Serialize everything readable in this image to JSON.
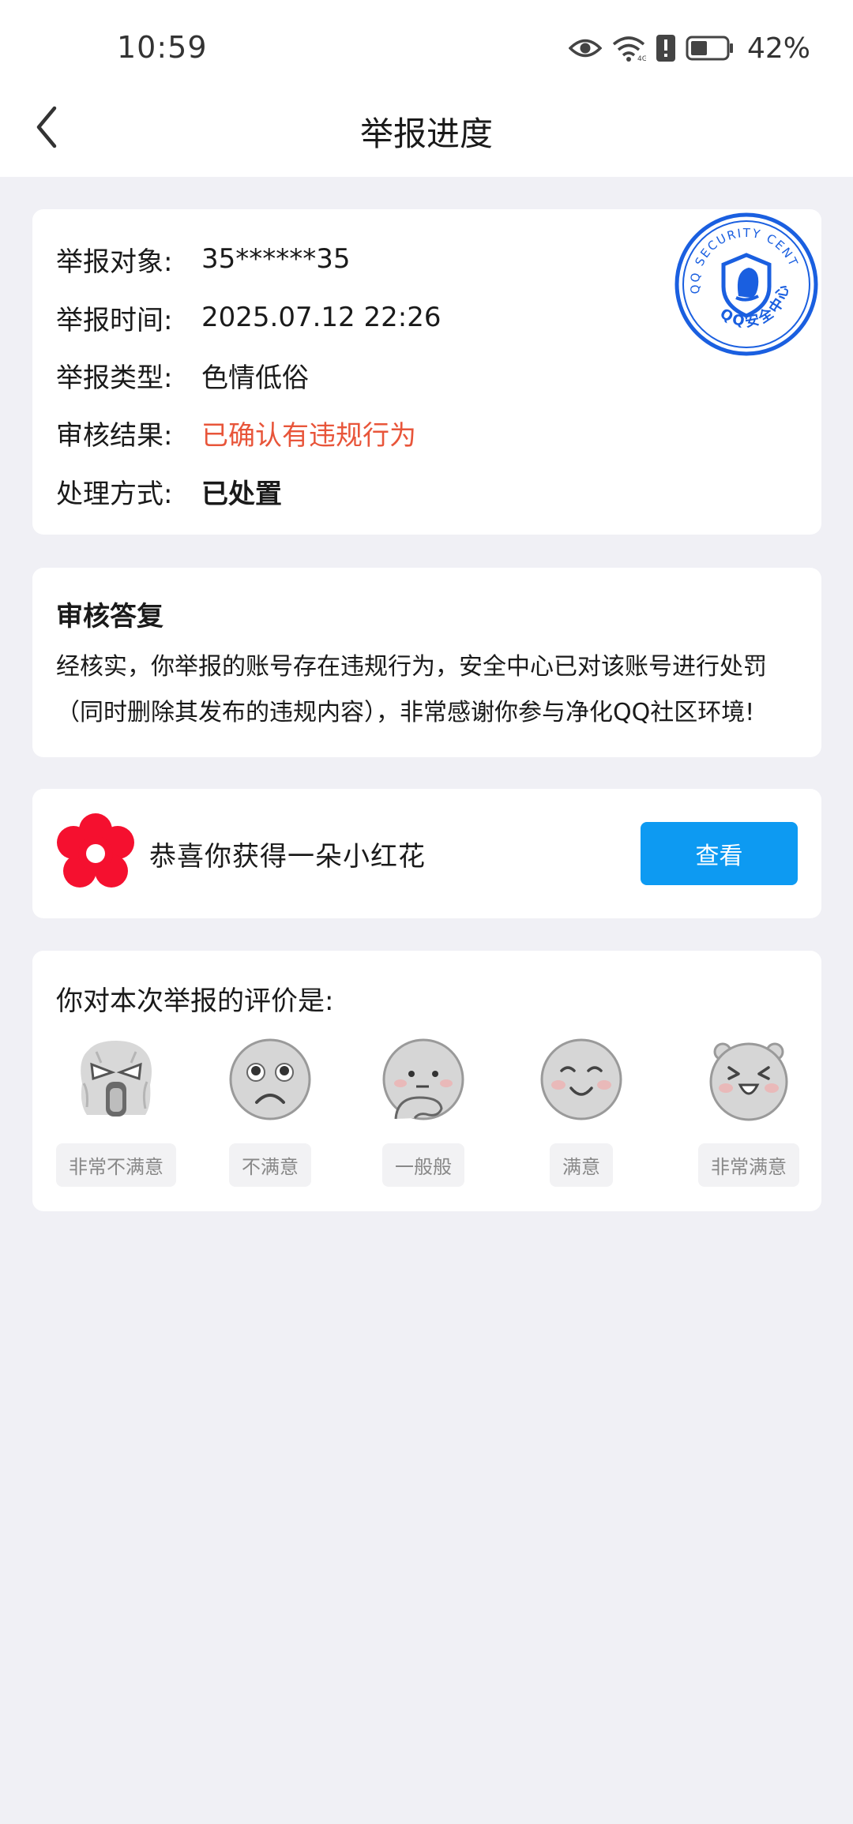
{
  "status_bar": {
    "time": "10:59",
    "battery": "42%",
    "icons": [
      "eye-icon",
      "wifi-icon",
      "alert-icon",
      "battery-icon"
    ]
  },
  "nav": {
    "title": "举报进度",
    "back_icon": "chevron-left-icon"
  },
  "info": {
    "rows": [
      {
        "label": "举报对象:",
        "value": "35******35"
      },
      {
        "label": "举报时间:",
        "value": "2025.07.12 22:26"
      },
      {
        "label": "举报类型:",
        "value": "色情低俗"
      },
      {
        "label": "审核结果:",
        "value": "已确认有违规行为"
      },
      {
        "label": "处理方式:",
        "value": "已处置"
      }
    ],
    "stamp": {
      "top_text": "QQ SECURITY CENTER",
      "bottom_text": "QQ安全中心"
    }
  },
  "reply": {
    "title": "审核答复",
    "text": "经核实，你举报的账号存在违规行为，安全中心已对该账号进行处罚（同时删除其发布的违规内容），非常感谢你参与净化QQ社区环境!"
  },
  "reward": {
    "text": "恭喜你获得一朵小红花",
    "button": "查看"
  },
  "rating": {
    "title": "你对本次举报的评价是:",
    "options": [
      {
        "label": "非常不满意"
      },
      {
        "label": "不满意"
      },
      {
        "label": "一般般"
      },
      {
        "label": "满意"
      },
      {
        "label": "非常满意"
      }
    ]
  },
  "colors": {
    "accent": "#0d9af2",
    "danger": "#e8553a",
    "flower": "#f5102f",
    "stamp": "#1a5fe0",
    "background": "#f0f0f5"
  }
}
